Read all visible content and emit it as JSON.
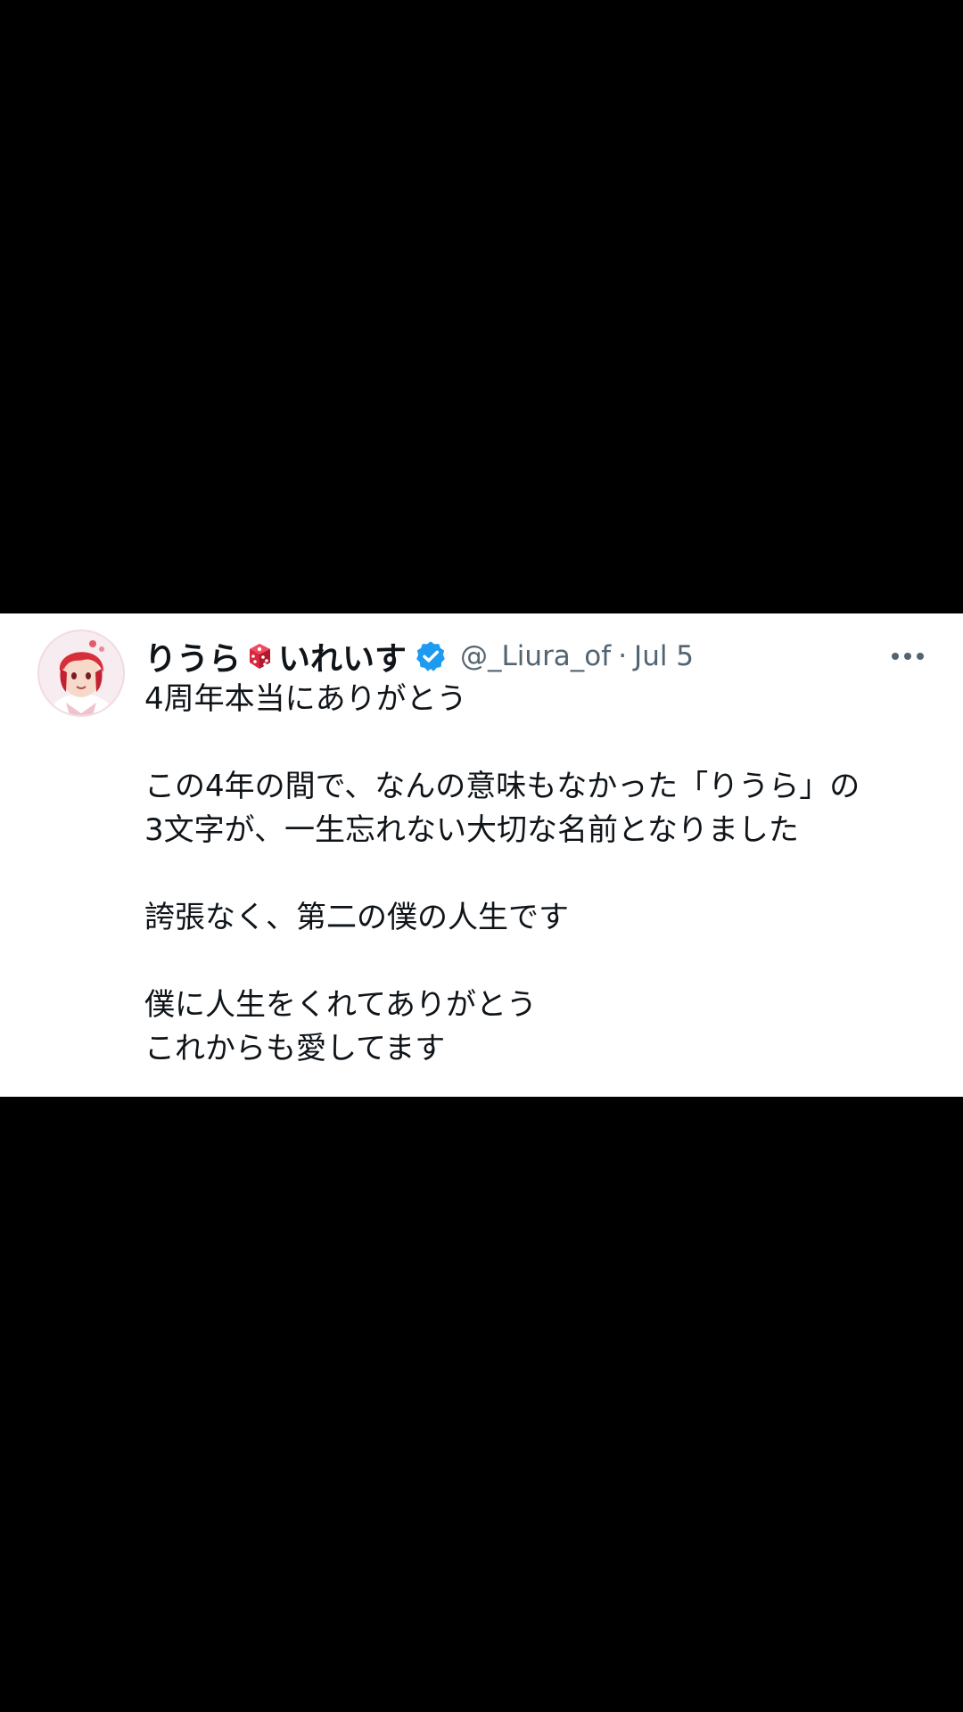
{
  "tweet": {
    "display_name_part1": "りうら",
    "display_name_part2": "いれいす",
    "handle": "@_Liura_of",
    "separator": "·",
    "timestamp": "Jul 5",
    "icons": {
      "name_emoji": "game-die-icon",
      "verified": "verified-badge-icon",
      "more": "more-options-icon",
      "avatar": "profile-avatar"
    },
    "body": {
      "line1": "4周年本当にありがとう",
      "line2": "この4年の間で、なんの意味もなかった「りうら」の",
      "line3": "3文字が、一生忘れない大切な名前となりました",
      "line4": "誇張なく、第二の僕の人生です",
      "line5": "僕に人生をくれてありがとう",
      "line6": "これからも愛してます"
    }
  },
  "colors": {
    "background": "#000000",
    "card": "#ffffff",
    "text_primary": "#0f1419",
    "text_secondary": "#536471",
    "verified_blue": "#1d9bf0",
    "dice_red": "#c8102e"
  }
}
